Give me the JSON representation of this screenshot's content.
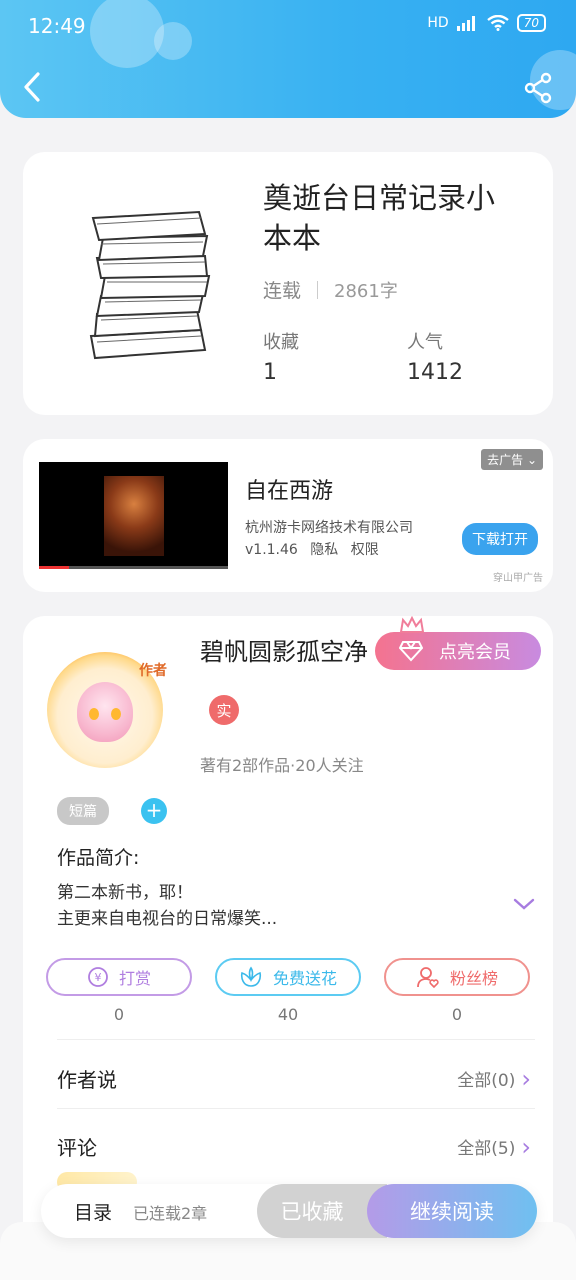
{
  "status_bar": {
    "time": "12:49",
    "network": "HD",
    "battery": "70"
  },
  "colors": {
    "header": "#38b1f2",
    "accent_purple": "#a77ce0",
    "reward": "#b07ee0",
    "flower": "#3bc2f0",
    "fans": "#ef6b6b"
  },
  "book": {
    "title": "奠逝台日常记录小本本",
    "status": "连载",
    "word_count": "2861字",
    "collect_label": "收藏",
    "collect_value": "1",
    "popularity_label": "人气",
    "popularity_value": "1412"
  },
  "ad": {
    "close_label": "去广告",
    "app_name": "自在西游",
    "company": "杭州游卡网络技术有限公司",
    "version": "v1.1.46",
    "privacy": "隐私",
    "permission": "权限",
    "download_label": "下载打开",
    "source": "穿山甲广告"
  },
  "author": {
    "avatar_tag": "作者",
    "name": "碧帆圆影孤空净",
    "vip_label": "点亮会员",
    "real_badge": "实",
    "info": "著有2部作品·20人关注"
  },
  "work": {
    "tag": "短篇",
    "add_tag": "+",
    "intro_heading": "作品简介:",
    "intro_line1": "第二本新书，耶！",
    "intro_line2": "主更来自电视台的日常爆笑..."
  },
  "actions": [
    {
      "label": "打赏",
      "count": "0",
      "icon": "yen-coin-icon"
    },
    {
      "label": "免费送花",
      "count": "40",
      "icon": "flower-icon"
    },
    {
      "label": "粉丝榜",
      "count": "0",
      "icon": "fan-user-icon"
    }
  ],
  "sections": {
    "author_says": "作者说",
    "author_says_link": "全部(0)",
    "comments": "评论",
    "comments_link": "全部(5)"
  },
  "bottom_bar": {
    "toc": "目录",
    "toc_status": "已连载2章",
    "collected": "已收藏",
    "continue": "继续阅读"
  }
}
